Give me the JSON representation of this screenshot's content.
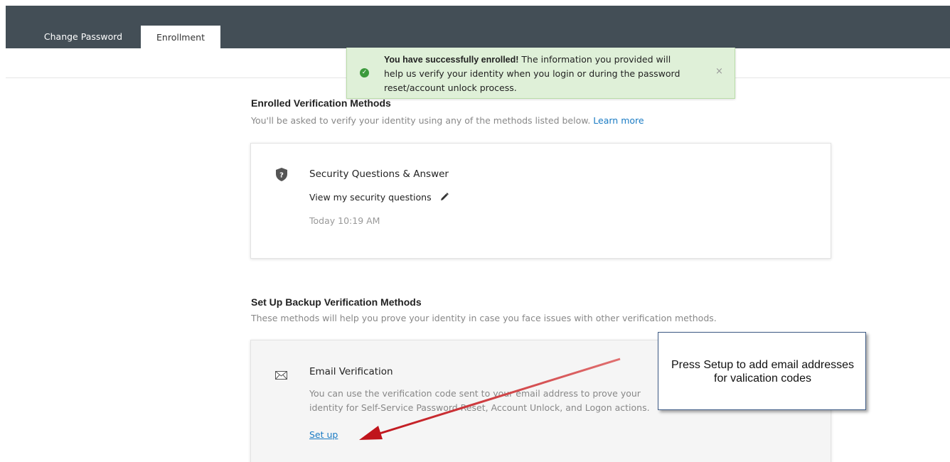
{
  "tabs": [
    {
      "label": "Change Password",
      "active": false
    },
    {
      "label": "Enrollment",
      "active": true
    }
  ],
  "toast": {
    "bold": "You have successfully enrolled!",
    "message": " The information you provided will help us verify your identity when you login or during the password reset/account unlock process.",
    "close": "×",
    "icon": "check-circle-icon"
  },
  "enrolled": {
    "title": "Enrolled Verification Methods",
    "subtitle": "You'll be asked to verify your identity using any of the methods listed below.",
    "learn_more": "Learn more",
    "method": {
      "icon": "shield-question-icon",
      "title": "Security Questions & Answer",
      "link": "View my security questions",
      "edit_icon": "pencil-icon",
      "time": "Today 10:19 AM"
    }
  },
  "backup": {
    "title": "Set Up Backup Verification Methods",
    "subtitle": "These methods will help you prove your identity in case you face issues with other verification methods.",
    "method": {
      "icon": "envelope-icon",
      "title": "Email Verification",
      "description": "You can use the verification code sent to your email address to prove your identity for Self-Service Password Reset, Account Unlock, and Logon actions.",
      "setup": "Set up"
    }
  },
  "callout": {
    "text": "Press Setup to add email addresses for valication codes"
  },
  "colors": {
    "topbar": "#434e56",
    "toast_bg": "#dff0d8",
    "link": "#1a7bc4",
    "arrow": "#c0141b"
  }
}
